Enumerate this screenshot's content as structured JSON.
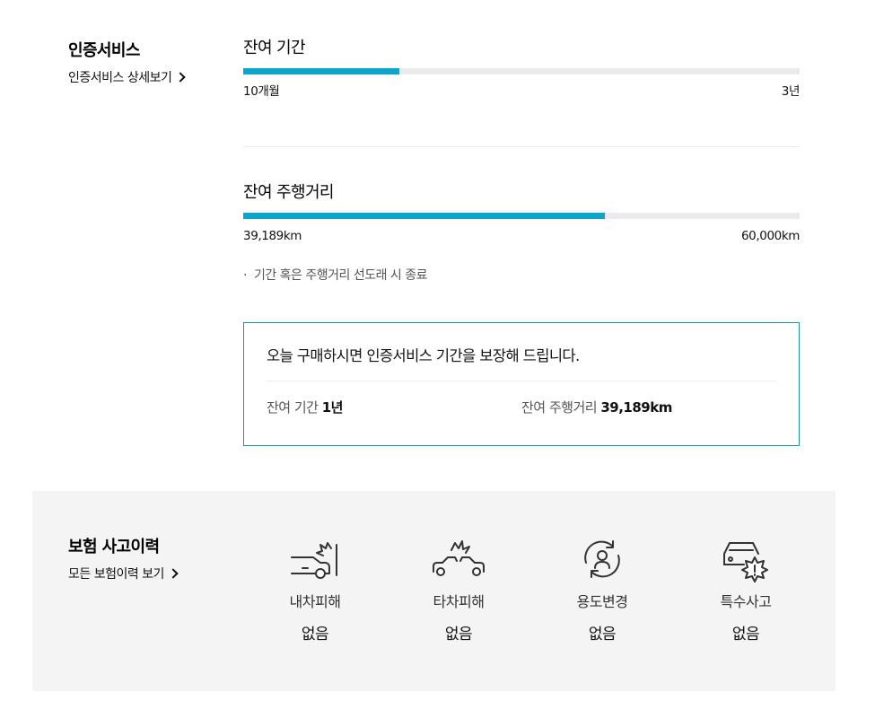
{
  "certification": {
    "title": "인증서비스",
    "detail_link": "인증서비스 상세보기",
    "period": {
      "title": "잔여 기간",
      "left_label": "10개월",
      "right_label": "3년",
      "progress": 0.28
    },
    "mileage": {
      "title": "잔여 주행거리",
      "left_label": "39,189km",
      "right_label": "60,000km",
      "progress": 0.65
    },
    "note": "기간 혹은 주행거리 선도래 시 종료",
    "note_bullet": "·",
    "guarantee": {
      "title": "오늘 구매하시면 인증서비스 기간을 보장해 드립니다.",
      "period_label": "잔여 기간",
      "period_value": "1년",
      "mileage_label": "잔여 주행거리",
      "mileage_value": "39,189km"
    }
  },
  "insurance": {
    "title": "보험 사고이력",
    "detail_link": "모든 보험이력 보기",
    "items": [
      {
        "icon": "own-car-damage-icon",
        "label": "내차피해",
        "value": "없음"
      },
      {
        "icon": "other-car-damage-icon",
        "label": "타차피해",
        "value": "없음"
      },
      {
        "icon": "usage-change-icon",
        "label": "용도변경",
        "value": "없음"
      },
      {
        "icon": "special-accident-icon",
        "label": "특수사고",
        "value": "없음"
      }
    ]
  },
  "colors": {
    "accent": "#08a6cb",
    "box_border": "#1893a3",
    "panel_bg": "#f4f4f4"
  }
}
